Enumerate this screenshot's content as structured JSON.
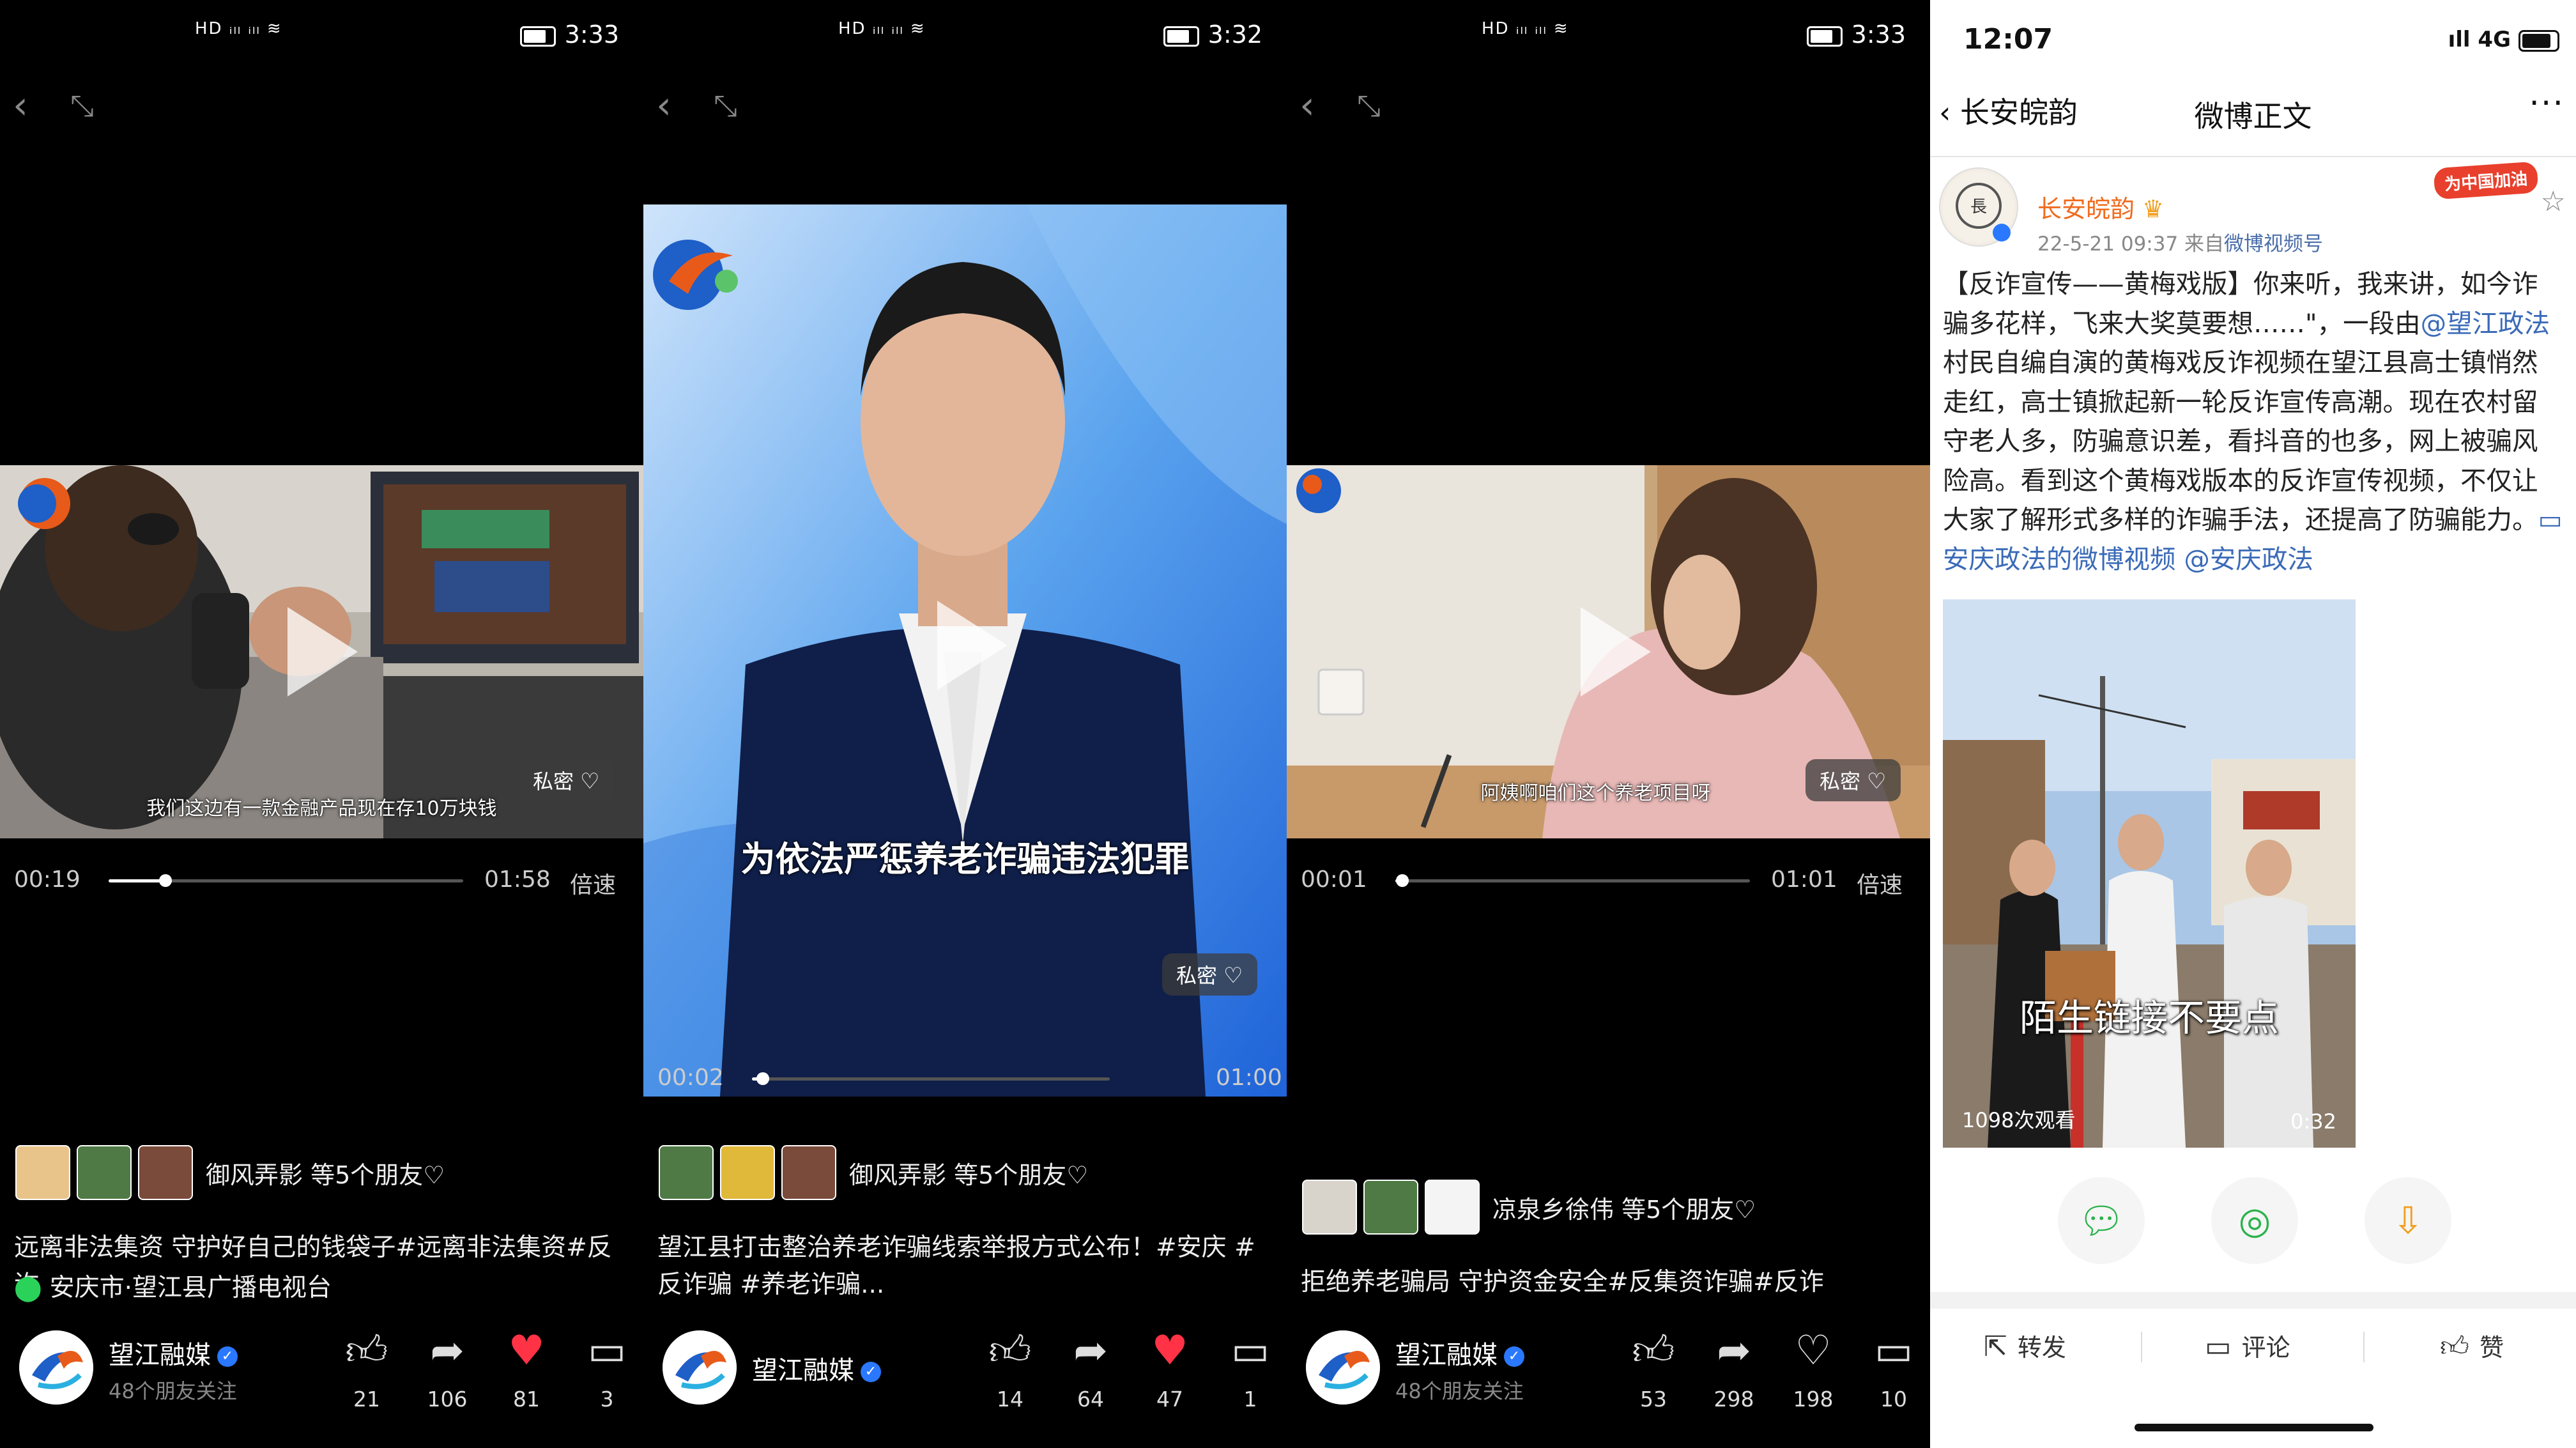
{
  "panels": [
    {
      "status": {
        "time": "3:33"
      },
      "caption": "我们这边有一款金融产品现在存10万块钱",
      "private_label": "私密",
      "progress": {
        "current": "00:19",
        "total": "01:58",
        "speed": "倍速",
        "ratio": 0.16
      },
      "friends_text": "御风弄影 等5个朋友♡",
      "description": "远离非法集资 守护好自己的钱袋子#远离非法集资#反诈",
      "location": "安庆市·望江县广播电视台",
      "account": {
        "name": "望江融媒",
        "followers": "48个朋友关注"
      },
      "actions": {
        "like": "21",
        "share": "106",
        "fav": "81",
        "comment": "3"
      }
    },
    {
      "status": {
        "time": "3:32"
      },
      "headline": "为依法严惩养老诈骗违法犯罪",
      "private_label": "私密",
      "progress": {
        "current": "00:02",
        "total": "01:00",
        "ratio": 0.03
      },
      "friends_text": "御风弄影 等5个朋友♡",
      "description": "望江县打击整治养老诈骗线索举报方式公布！#安庆 #反诈骗 #养老诈骗...",
      "account": {
        "name": "望江融媒"
      },
      "actions": {
        "like": "14",
        "share": "64",
        "fav": "47",
        "comment": "1"
      }
    },
    {
      "status": {
        "time": "3:33"
      },
      "caption": "阿姨啊咱们这个养老项目呀",
      "private_label": "私密",
      "progress": {
        "current": "00:01",
        "total": "01:01",
        "speed": "倍速",
        "ratio": 0.02
      },
      "friends_text": "凉泉乡徐伟 等5个朋友♡",
      "description": "拒绝养老骗局 守护资金安全#反集资诈骗#反诈",
      "account": {
        "name": "望江融媒",
        "followers": "48个朋友关注"
      },
      "actions": {
        "like": "53",
        "share": "298",
        "fav": "198",
        "comment": "10"
      }
    }
  ],
  "weibo": {
    "status": {
      "time": "12:07",
      "network": "4G"
    },
    "nav": {
      "back": "长安皖韵",
      "title": "微博正文",
      "more": "···"
    },
    "badge": "为中国加油",
    "user": "长安皖韵",
    "meta": "22-5-21 09:37  来自",
    "source": "微博视频号",
    "text": {
      "part1": "【反诈宣传——黄梅戏版】你来听，我来讲，如今诈骗多花样，飞来大奖莫要想……\"，一段由",
      "mention1": "@望江政法",
      "part2": " 村民自编自演的黄梅戏反诈视频在望江县高士镇悄然走红，高士镇掀起新一轮反诈宣传高潮。现在农村留守老人多，防骗意识差，看抖音的也多，网上被骗风险高。看到这个黄梅戏版本的反诈宣传视频，不仅让大家了解形式多样的诈骗手法，还提高了防骗能力。",
      "link": "安庆政法的微博视频",
      "mention2": "@安庆政法"
    },
    "video": {
      "caption": "陌生链接不要点",
      "views": "1098次观看",
      "duration": "0:32"
    },
    "bottom": {
      "repost": "转发",
      "comment": "评论",
      "like": "赞"
    }
  }
}
